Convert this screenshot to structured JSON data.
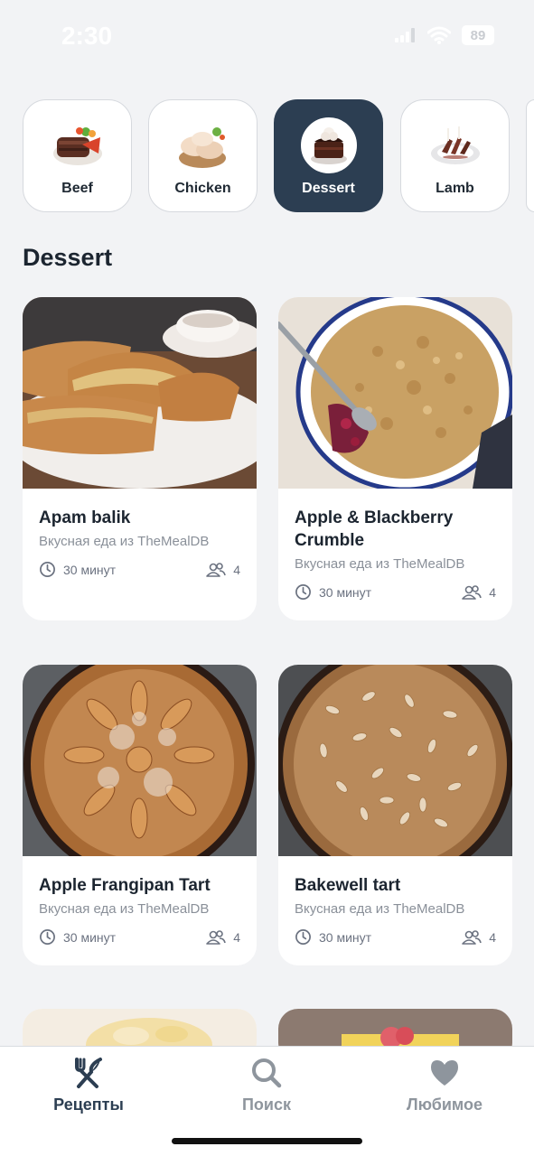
{
  "status_bar": {
    "time": "2:30",
    "battery": "89"
  },
  "categories": [
    {
      "label": "Beef",
      "icon": "beef-icon",
      "active": false
    },
    {
      "label": "Chicken",
      "icon": "chicken-icon",
      "active": false
    },
    {
      "label": "Dessert",
      "icon": "dessert-icon",
      "active": true
    },
    {
      "label": "Lamb",
      "icon": "lamb-icon",
      "active": false
    }
  ],
  "section": {
    "title": "Dessert"
  },
  "recipes": [
    {
      "title": "Apam balik",
      "subtitle": "Вкусная еда из TheMealDB",
      "time": "30 минут",
      "servings": "4"
    },
    {
      "title": "Apple & Blackberry Crumble",
      "subtitle": "Вкусная еда из TheMealDB",
      "time": "30 минут",
      "servings": "4"
    },
    {
      "title": "Apple Frangipan Tart",
      "subtitle": "Вкусная еда из TheMealDB",
      "time": "30 минут",
      "servings": "4"
    },
    {
      "title": "Bakewell tart",
      "subtitle": "Вкусная еда из TheMealDB",
      "time": "30 минут",
      "servings": "4"
    }
  ],
  "tabbar": {
    "recipes": "Рецепты",
    "search": "Поиск",
    "favorites": "Любимое"
  },
  "colors": {
    "accent": "#2c3e52",
    "background": "#f2f3f5",
    "inactive_tab": "#8e959d"
  }
}
